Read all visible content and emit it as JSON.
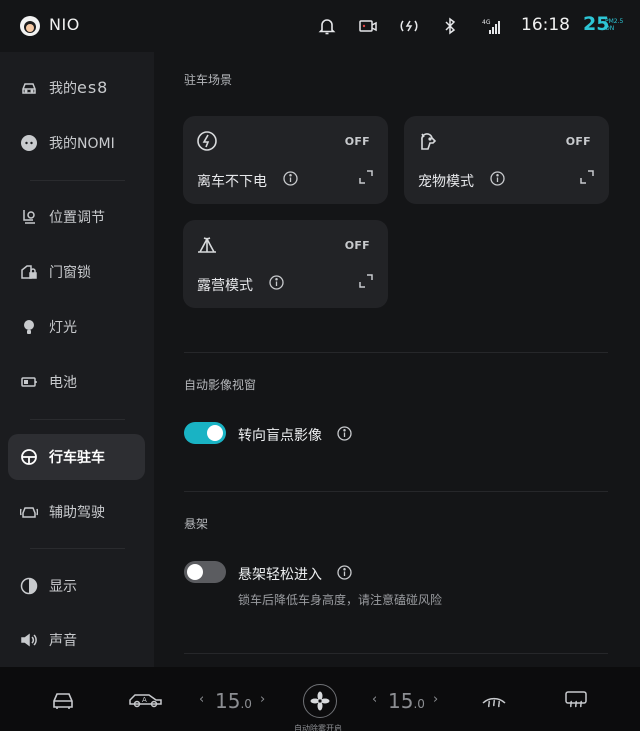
{
  "status": {
    "brand": "NIO",
    "network": "4G",
    "time": "16:18",
    "aqi_value": "25",
    "aqi_label_line1": "PM2.5",
    "aqi_label_line2": "ON",
    "icons": [
      "bell-icon",
      "dashcam-icon",
      "wireless-charging-icon",
      "bluetooth-icon",
      "signal-icon"
    ]
  },
  "sidebar": {
    "items": [
      {
        "label": "我的",
        "suffix": "es8",
        "icon": "car-icon"
      },
      {
        "label": "我的NOMI",
        "icon": "nomi-icon"
      },
      {
        "label": "位置调节",
        "icon": "seat-icon"
      },
      {
        "label": "门窗锁",
        "icon": "door-lock-icon"
      },
      {
        "label": "灯光",
        "icon": "light-icon"
      },
      {
        "label": "电池",
        "icon": "battery-icon"
      },
      {
        "label": "行车驻车",
        "icon": "steering-wheel-icon",
        "active": true
      },
      {
        "label": "辅助驾驶",
        "icon": "assist-drive-icon"
      },
      {
        "label": "显示",
        "icon": "display-icon"
      },
      {
        "label": "声音",
        "icon": "sound-icon"
      }
    ]
  },
  "parking": {
    "title": "驻车场景",
    "cards": [
      {
        "title": "离车不下电",
        "state": "OFF",
        "icon": "lightning-icon"
      },
      {
        "title": "宠物模式",
        "state": "OFF",
        "icon": "pet-icon"
      },
      {
        "title": "露营模式",
        "state": "OFF",
        "icon": "tent-icon"
      }
    ]
  },
  "camera": {
    "title": "自动影像视窗",
    "toggle_label": "转向盲点影像",
    "toggle_on": true
  },
  "suspension": {
    "title": "悬架",
    "toggle_label": "悬架轻松进入",
    "toggle_on": false,
    "description": "锁车后降低车身高度，请注意磕碰风险"
  },
  "dock": {
    "temp_left": "15",
    "temp_left_dec": ".0",
    "temp_right": "15",
    "temp_right_dec": ".0",
    "fan_label": "自动除雾开启",
    "chevron_left": "‹",
    "chevron_right": "›"
  },
  "colors": {
    "accent": "#19b3c4",
    "aqi": "#2dc6d6",
    "background": "#141517",
    "card": "#222326"
  }
}
